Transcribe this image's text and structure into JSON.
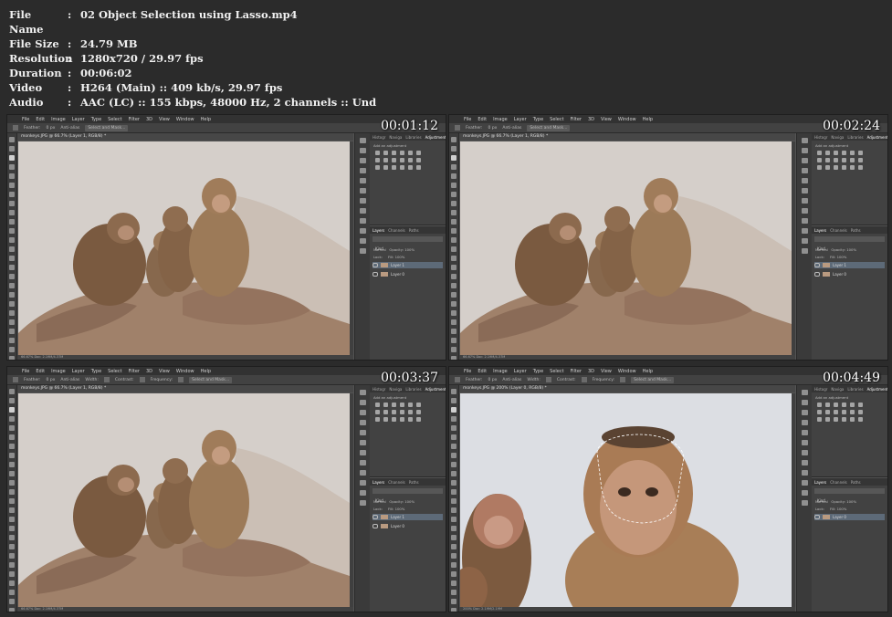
{
  "file_info": [
    {
      "key": "File Name",
      "value": "02 Object Selection using Lasso.mp4"
    },
    {
      "key": "File Size",
      "value": "24.79 MB"
    },
    {
      "key": "Resolution",
      "value": "1280x720 / 29.97 fps"
    },
    {
      "key": "Duration",
      "value": "00:06:02"
    },
    {
      "key": "Video",
      "value": "H264 (Main) :: 409 kb/s, 29.97 fps"
    },
    {
      "key": "Audio",
      "value": "AAC (LC) :: 155 kbps, 48000 Hz, 2 channels :: Und"
    }
  ],
  "separator": ":",
  "menus": [
    "File",
    "Edit",
    "Image",
    "Layer",
    "Type",
    "Select",
    "Filter",
    "3D",
    "View",
    "Window",
    "Help"
  ],
  "options": {
    "feather": "Feather:",
    "feather_val": "0 px",
    "anti_alias": "Anti-alias",
    "select_mask": "Select and Mask..."
  },
  "options_more": {
    "width": "Width:",
    "contrast": "Contrast:",
    "frequency": "Frequency:"
  },
  "panels": {
    "tabs_top": [
      "Histogr",
      "Naviga",
      "Libraries",
      "Adjustments"
    ],
    "add_adjustment": "Add an adjustment",
    "tabs_layers": [
      "Layers",
      "Channels",
      "Paths"
    ],
    "kind": "Kind",
    "normal": "Normal",
    "opacity": "Opacity:",
    "opacity_val": "100%",
    "lock": "Lock:",
    "fill": "Fill:",
    "fill_val": "100%"
  },
  "thumbs": [
    {
      "timestamp": "00:01:12",
      "doc_tab": "monkeys.JPG @ 66.7% (Layer 1, RGB/8) *",
      "status": "66.67%   Doc: 2.19M/4.37M",
      "layers": [
        "Layer 1",
        "Layer 0"
      ]
    },
    {
      "timestamp": "00:02:24",
      "doc_tab": "monkeys.JPG @ 66.7% (Layer 1, RGB/8) *",
      "status": "66.67%   Doc: 2.19M/4.37M",
      "layers": [
        "Layer 1",
        "Layer 0"
      ]
    },
    {
      "timestamp": "00:03:37",
      "doc_tab": "monkeys.JPG @ 66.7% (Layer 1, RGB/8) *",
      "status": "66.67%   Doc: 2.19M/4.37M",
      "layers": [
        "Layer 1",
        "Layer 0"
      ]
    },
    {
      "timestamp": "00:04:49",
      "doc_tab": "monkeys.JPG @ 200% (Layer 0, RGB/8) *",
      "status": "200%   Doc: 2.19M/2.19M",
      "layers": [
        "Layer 0"
      ]
    }
  ]
}
